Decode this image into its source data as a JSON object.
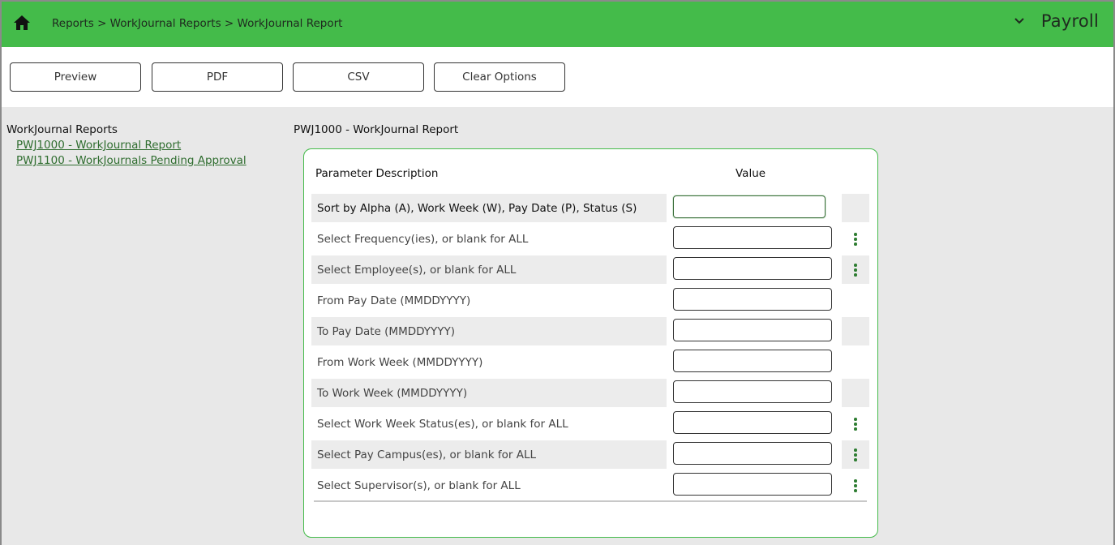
{
  "header": {
    "breadcrumb": "Reports > WorkJournal Reports > WorkJournal Report",
    "module": "Payroll",
    "colors": {
      "header_bg": "#44bb4a",
      "link": "#2f6d2f"
    }
  },
  "toolbar": {
    "preview_label": "Preview",
    "pdf_label": "PDF",
    "csv_label": "CSV",
    "clear_label": "Clear Options"
  },
  "sidebar": {
    "title": "WorkJournal Reports",
    "items": [
      {
        "label": "PWJ1000 - WorkJournal Report"
      },
      {
        "label": "PWJ1100 - WorkJournals Pending Approval"
      }
    ]
  },
  "report": {
    "title": "PWJ1000 - WorkJournal Report",
    "col_desc": "Parameter Description",
    "col_value": "Value",
    "params": [
      {
        "label": "Sort by Alpha (A), Work Week (W), Pay Date (P), Status (S)",
        "value": "",
        "lookup": false
      },
      {
        "label": "Select Frequency(ies), or blank for ALL",
        "value": "",
        "lookup": true
      },
      {
        "label": "Select Employee(s), or blank for ALL",
        "value": "",
        "lookup": true
      },
      {
        "label": "From Pay Date (MMDDYYYY)",
        "value": "",
        "lookup": false
      },
      {
        "label": "To Pay Date (MMDDYYYY)",
        "value": "",
        "lookup": false
      },
      {
        "label": "From Work Week (MMDDYYYY)",
        "value": "",
        "lookup": false
      },
      {
        "label": "To Work Week (MMDDYYYY)",
        "value": "",
        "lookup": false
      },
      {
        "label": "Select Work Week Status(es), or blank for ALL",
        "value": "",
        "lookup": true
      },
      {
        "label": "Select Pay Campus(es), or blank for ALL",
        "value": "",
        "lookup": true
      },
      {
        "label": "Select Supervisor(s), or blank for ALL",
        "value": "",
        "lookup": true
      }
    ]
  },
  "icons": [
    "home-icon",
    "chevron-down-icon",
    "kebab-menu-icon"
  ]
}
